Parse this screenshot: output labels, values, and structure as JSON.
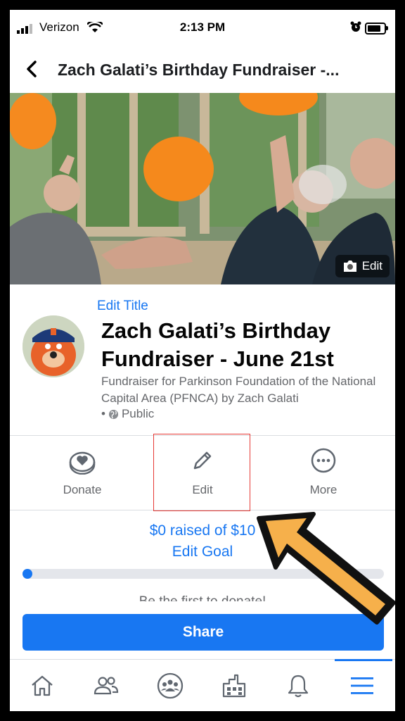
{
  "status_bar": {
    "carrier": "Verizon",
    "time": "2:13 PM"
  },
  "header": {
    "title": "Zach Galati’s Birthday Fundraiser -..."
  },
  "cover": {
    "edit_label": "Edit"
  },
  "fundraiser": {
    "edit_title_label": "Edit Title",
    "title": "Zach Galati’s Birthday Fundraiser - June 21st",
    "subtitle": "Fundraiser for Parkinson Foundation of the National Capital Area (PFNCA) by Zach Galati",
    "privacy_label": "Public"
  },
  "actions": [
    {
      "label": "Donate",
      "icon": "donate-heart-coin-icon"
    },
    {
      "label": "Edit",
      "icon": "pencil-icon"
    },
    {
      "label": "More",
      "icon": "more-dots-icon"
    }
  ],
  "progress": {
    "raised_text": "$0 raised of $10",
    "edit_goal_label": "Edit Goal",
    "raised_fraction": 0,
    "first_donate_text": "Be the first to donate!"
  },
  "share": {
    "label": "Share"
  },
  "tab_bar": {
    "items": [
      {
        "icon": "home-icon"
      },
      {
        "icon": "friends-icon"
      },
      {
        "icon": "groups-icon"
      },
      {
        "icon": "marketplace-icon"
      },
      {
        "icon": "notifications-bell-icon"
      },
      {
        "icon": "menu-hamburger-icon",
        "active": true
      }
    ]
  },
  "colors": {
    "accent": "#1877f2",
    "annotation_arrow": "#f6b04b",
    "highlight_box": "#e53935"
  }
}
